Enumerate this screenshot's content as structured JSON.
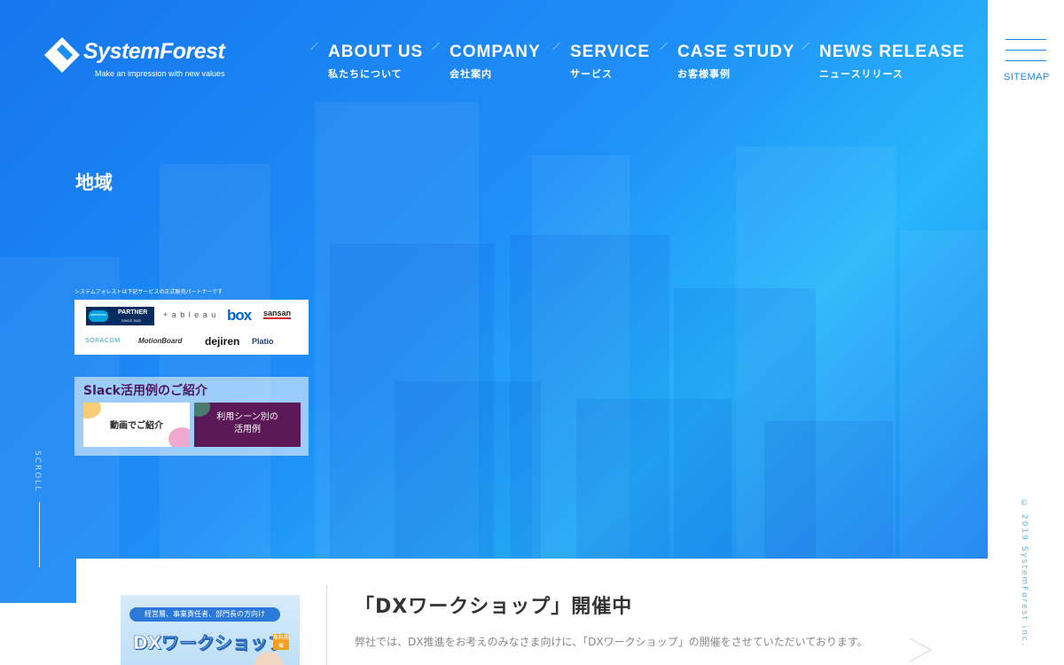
{
  "brand": {
    "name": "SystemForest",
    "tagline": "Make an impression with new values"
  },
  "nav": [
    {
      "en": "ABOUT US",
      "ja": "私たちについて"
    },
    {
      "en": "COMPANY",
      "ja": "会社案内"
    },
    {
      "en": "SERVICE",
      "ja": "サービス"
    },
    {
      "en": "CASE STUDY",
      "ja": "お客様事例"
    },
    {
      "en": "NEWS RELEASE",
      "ja": "ニュースリリース"
    }
  ],
  "sitemap_label": "SITEMAP",
  "page_title": "地域",
  "partners": {
    "caption": "システムフォレストは下記サービスの正式販売パートナーです",
    "logos": [
      "salesforce",
      "PARTNER",
      "SINCE 2022",
      "+ a b l e a u",
      "box",
      "sansan",
      "SORACOM",
      "MotionBoard",
      "dejiren",
      "Platio"
    ]
  },
  "slack": {
    "title": "Slack活用例のご紹介",
    "video_label": "動画でご紹介",
    "scene_label_1": "利用シーン別の",
    "scene_label_2": "活用例"
  },
  "scroll_label": "SCROLL",
  "copyright": "© 2019 SystemForest inc.",
  "news": {
    "thumb_sub": "経営層、事業責任者、部門長の方向け",
    "thumb_title": "DXワークショップ",
    "thumb_badge": "無料開催",
    "title": "「DXワークショップ」開催中",
    "body": "弊社では、DX推進をお考えのみなさま向けに、「DXワークショップ」の開催をさせていただいております。"
  },
  "colors": {
    "hero_primary": "#1e8ef7",
    "accent": "#1a86ea",
    "slack_purple": "#5a1856"
  }
}
